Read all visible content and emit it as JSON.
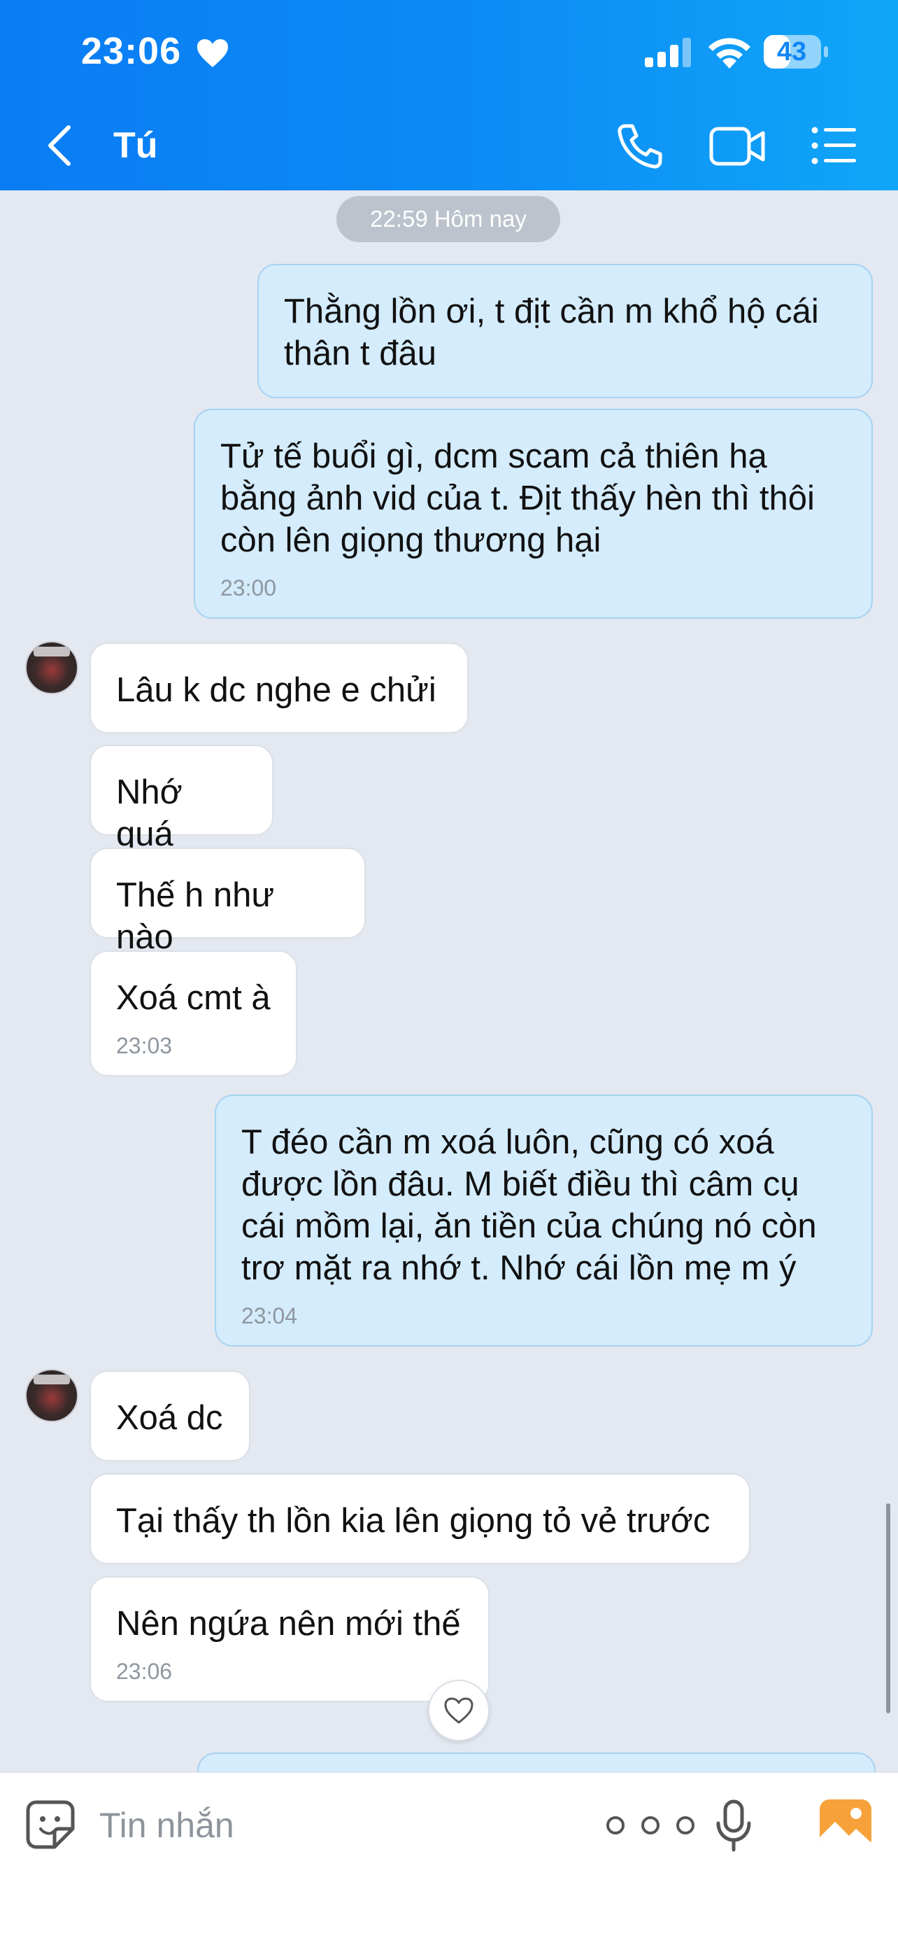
{
  "status_bar": {
    "time": "23:06",
    "battery": "43"
  },
  "header": {
    "contact_name": "Tú"
  },
  "date_separator": "22:59 Hôm nay",
  "messages": [
    {
      "side": "sent",
      "text": "Thằng lồn ơi, t địt cần m khổ hộ cái\nthân t đâu",
      "time": ""
    },
    {
      "side": "sent",
      "text": "Tử tế buổi gì, dcm scam cả thiên hạ\nbằng ảnh vid của t. Địt thấy hèn thì thôi\ncòn lên giọng thương hại",
      "time": "23:00"
    },
    {
      "side": "received",
      "text": "Lâu k dc nghe e chửi",
      "time": ""
    },
    {
      "side": "received",
      "text": "Nhớ quá",
      "time": ""
    },
    {
      "side": "received",
      "text": "Thế h như nào",
      "time": ""
    },
    {
      "side": "received",
      "text": "Xoá cmt à",
      "time": "23:03"
    },
    {
      "side": "sent",
      "text": "T đéo cần m xoá luôn, cũng có xoá\nđược lồn đâu. M biết điều thì câm cụ\ncái mồm lại, ăn tiền của chúng nó còn\ntrơ mặt ra nhớ t. Nhớ cái lồn mẹ m ý",
      "time": "23:04"
    },
    {
      "side": "received",
      "text": "Xoá dc",
      "time": ""
    },
    {
      "side": "received",
      "text": "Tại thấy th lồn kia lên giọng tỏ vẻ trước",
      "time": ""
    },
    {
      "side": "received",
      "text": "Nên ngứa nên mới thế",
      "time": "23:06"
    }
  ],
  "composer": {
    "placeholder": "Tin nhắn"
  },
  "icons": {
    "back": "back-icon",
    "call": "call-icon",
    "video": "video-icon",
    "menu": "menu-icon",
    "sticker": "sticker-icon",
    "more": "more-icon",
    "mic": "mic-icon",
    "image": "image-icon",
    "reaction": "heart-reaction-icon"
  },
  "colors": {
    "header_gradient_start": "#0a7cf3",
    "header_gradient_end": "#10a6f7",
    "chat_background": "#e3e8f1",
    "sent_bubble": "#d4ecfc",
    "received_bubble": "#ffffff",
    "image_icon": "#f6a13a"
  }
}
